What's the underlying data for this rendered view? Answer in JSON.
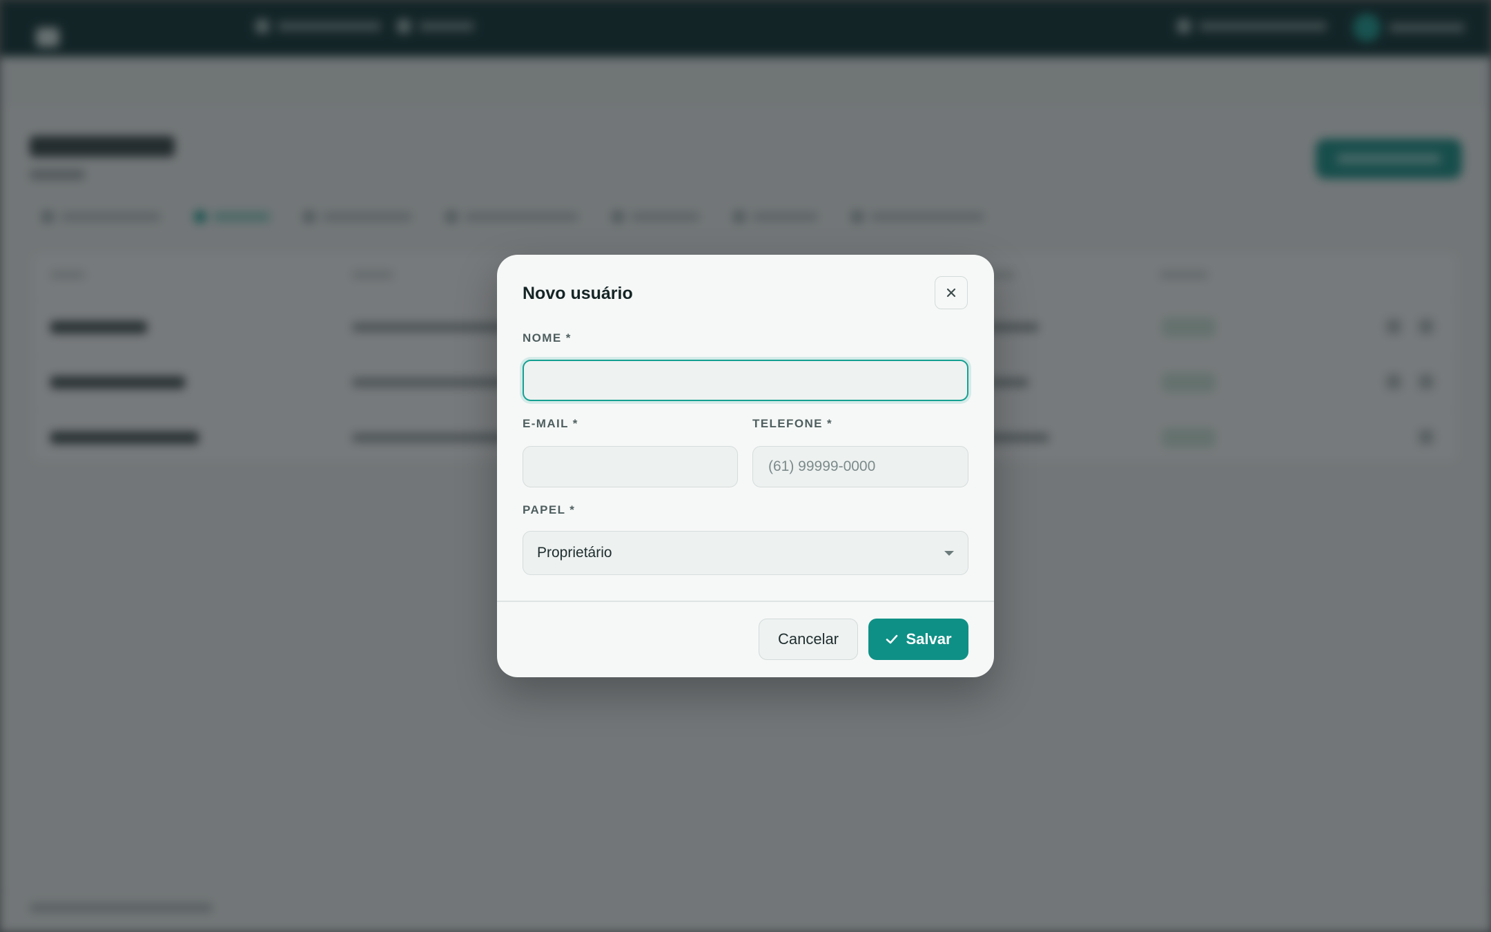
{
  "modal": {
    "title": "Novo usuário",
    "name_label": "NOME *",
    "name_value": "",
    "email_label": "E-MAIL *",
    "email_value": "",
    "phone_label": "TELEFONE *",
    "phone_placeholder": "(61) 99999-0000",
    "role_label": "PAPEL *",
    "role_value": "Proprietário",
    "cancel_label": "Cancelar",
    "save_label": "Salvar"
  },
  "colors": {
    "accent": "#0f9086",
    "focus_ring": "#14a092",
    "topbar": "#062a2c",
    "status_bg": "#cfeadb"
  },
  "icons": {
    "close": "close-icon",
    "save": "check-icon",
    "select": "chevron-down-icon"
  }
}
